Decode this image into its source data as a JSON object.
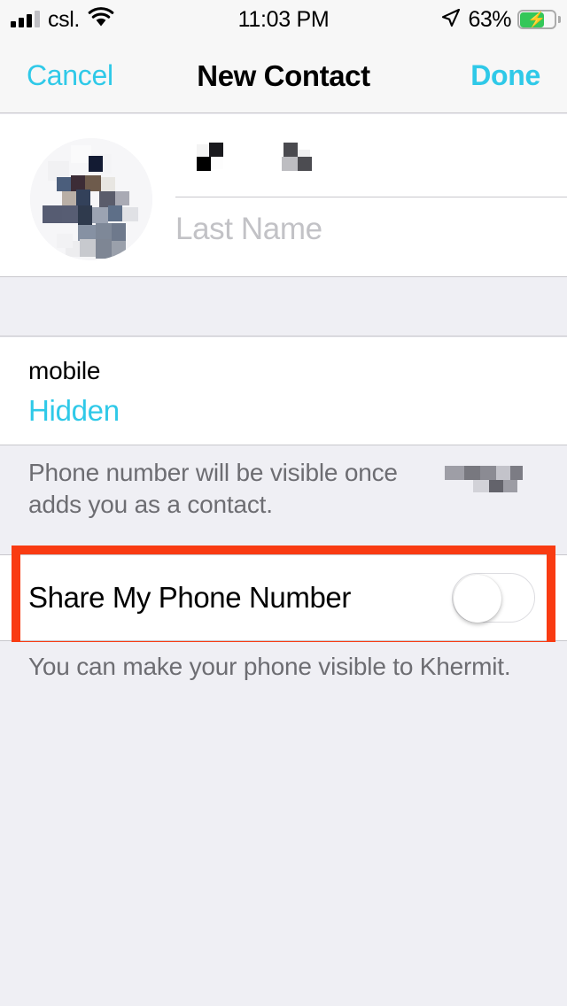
{
  "status_bar": {
    "carrier": "csl.",
    "time": "11:03 PM",
    "battery_percent": "63%",
    "battery_level": 63,
    "charging": true,
    "signal_bars_filled": 3,
    "signal_bars_total": 4,
    "wifi_icon": "wifi-icon",
    "location_icon": "location-arrow-icon",
    "battery_icon": "battery-charging-icon"
  },
  "nav": {
    "cancel_label": "Cancel",
    "title": "New Contact",
    "done_label": "Done"
  },
  "name_section": {
    "avatar_label": "contact-photo",
    "first_name_value": "",
    "first_name_redacted": true,
    "last_name_placeholder": "Last Name",
    "last_name_value": ""
  },
  "phone_section": {
    "label": "mobile",
    "value": "Hidden"
  },
  "footer_visibility": {
    "line1": "Phone number will be visible once",
    "line2": "adds you as a contact.",
    "redacted_name": true
  },
  "share_row": {
    "label": "Share My Phone Number",
    "toggle_state": "off",
    "toggle_on": false
  },
  "footer_share": {
    "text": "You can make your phone visible to Khermit."
  },
  "annotation": {
    "type": "highlight-box",
    "target": "share-my-phone-number-row",
    "color": "#F93B12"
  },
  "colors": {
    "accent": "#2FC9E8",
    "nav_background": "#F7F7F7",
    "group_background": "#EFEFF4",
    "cell_background": "#FFFFFF",
    "separator": "#C8C7CC",
    "footer_text": "#6D6D72",
    "placeholder_text": "#C2C2C6",
    "battery_green": "#34C759",
    "annotation_orange": "#F93B12"
  }
}
